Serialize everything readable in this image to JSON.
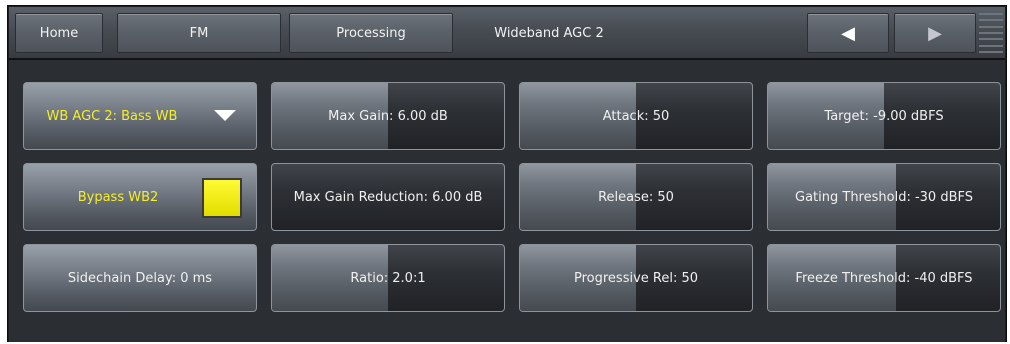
{
  "nav": {
    "home_label": "Home",
    "fm_label": "FM",
    "processing_label": "Processing",
    "page_title": "Wideband AGC 2",
    "prev_glyph": "◀",
    "next_glyph": "▶"
  },
  "controls": {
    "preset_select": {
      "label": "WB AGC 2: Bass WB",
      "icon": "chevron-down-icon"
    },
    "bypass": {
      "label": "Bypass WB2",
      "state": "on",
      "color": "#f4ef2a"
    },
    "sidechain_delay": {
      "label": "Sidechain Delay: 0 ms"
    },
    "max_gain": {
      "label": "Max Gain: 6.00 dB",
      "level": 0.5
    },
    "max_gain_reduction": {
      "label": "Max Gain Reduction: 6.00 dB",
      "level": 0.0
    },
    "ratio": {
      "label": "Ratio: 2.0:1",
      "level": 0.5
    },
    "attack": {
      "label": "Attack: 50",
      "level": 0.5
    },
    "release": {
      "label": "Release: 50",
      "level": 0.5
    },
    "progressive_rel": {
      "label": "Progressive Rel: 50",
      "level": 0.5
    },
    "target": {
      "label": "Target: -9.00 dBFS",
      "level": 0.5
    },
    "gating_threshold": {
      "label": "Gating Threshold: -30 dBFS",
      "level": 0.55
    },
    "freeze_threshold": {
      "label": "Freeze Threshold: -40 dBFS",
      "level": 0.55
    }
  },
  "colors": {
    "accent_yellow": "#f4ef2a",
    "panel": "#2b2e33"
  }
}
